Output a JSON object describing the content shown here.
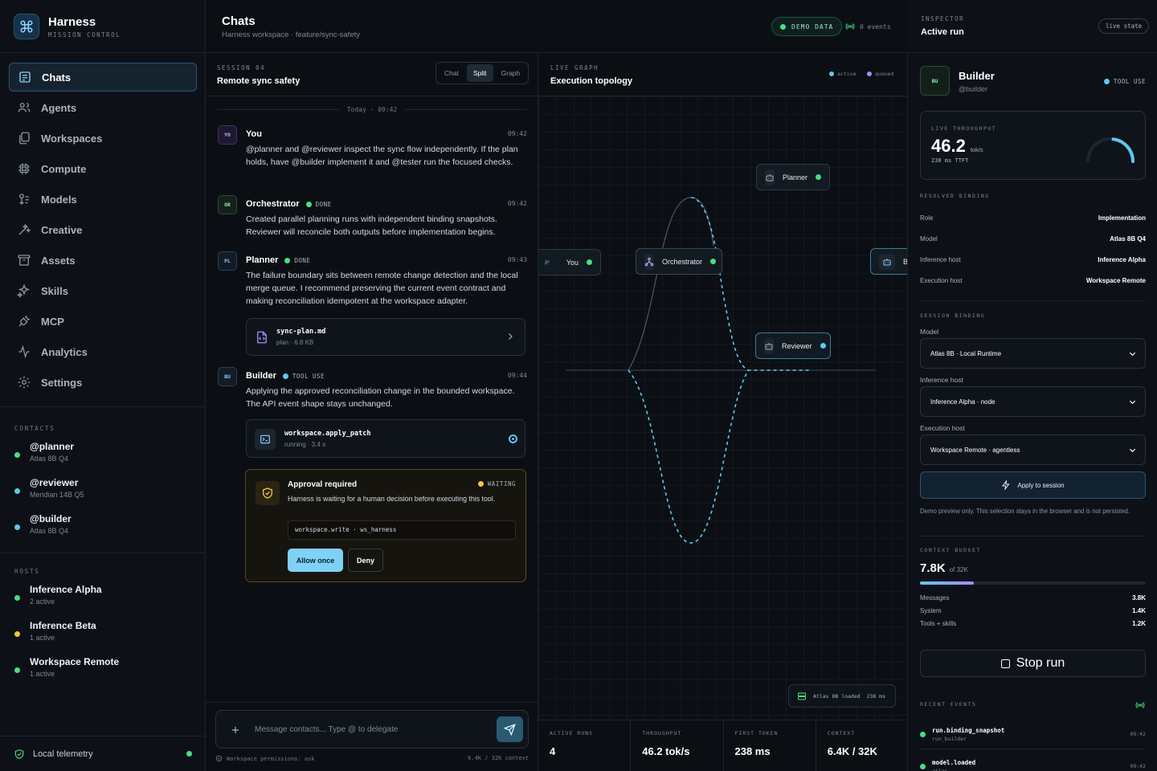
{
  "app": {
    "name": "Harness",
    "subtitle": "MISSION CONTROL"
  },
  "nav": [
    {
      "label": "Chats",
      "icon": "chat-icon",
      "active": true
    },
    {
      "label": "Agents",
      "icon": "users-icon"
    },
    {
      "label": "Workspaces",
      "icon": "workspaces-icon"
    },
    {
      "label": "Compute",
      "icon": "chip-icon"
    },
    {
      "label": "Models",
      "icon": "models-icon"
    },
    {
      "label": "Creative",
      "icon": "wand-icon"
    },
    {
      "label": "Assets",
      "icon": "archive-icon"
    },
    {
      "label": "Skills",
      "icon": "sparkles-icon"
    },
    {
      "label": "MCP",
      "icon": "plug-icon"
    },
    {
      "label": "Analytics",
      "icon": "activity-icon"
    },
    {
      "label": "Settings",
      "icon": "gear-icon"
    }
  ],
  "contacts": {
    "label": "CONTACTS",
    "items": [
      {
        "name": "@planner",
        "model": "Atlas 8B Q4",
        "color": "#4ade80"
      },
      {
        "name": "@reviewer",
        "model": "Meridian 14B Q5",
        "color": "#5ec8f0"
      },
      {
        "name": "@builder",
        "model": "Atlas 8B Q4",
        "color": "#5ec8f0"
      }
    ]
  },
  "hosts": {
    "label": "HOSTS",
    "items": [
      {
        "name": "Inference Alpha",
        "status": "2 active",
        "color": "#4ade80"
      },
      {
        "name": "Inference Beta",
        "status": "1 active",
        "color": "#f5c542"
      },
      {
        "name": "Workspace Remote",
        "status": "1 active",
        "color": "#4ade80"
      }
    ]
  },
  "telemetry": {
    "label": "Local telemetry"
  },
  "header": {
    "title": "Chats",
    "subtitle": "Harness workspace · feature/sync-safety",
    "badge": "DEMO DATA",
    "events": "0 events"
  },
  "chat": {
    "session_label": "SESSION 04",
    "session_title": "Remote sync safety",
    "views": [
      "Chat",
      "Split",
      "Graph"
    ],
    "active_view": "Split",
    "date_divider": "Today · 09:42",
    "messages": [
      {
        "avatar": "YO",
        "name": "You",
        "time": "09:42",
        "body": "@planner and @reviewer inspect the sync flow independently. If the plan holds, have @builder implement it and @tester run the focused checks."
      },
      {
        "avatar": "OR",
        "name": "Orchestrator",
        "status": "DONE",
        "time": "09:42",
        "body": "Created parallel planning runs with independent binding snapshots. Reviewer will reconcile both outputs before implementation begins."
      },
      {
        "avatar": "PL",
        "name": "Planner",
        "status": "DONE",
        "time": "09:43",
        "body": "The failure boundary sits between remote change detection and the local merge queue. I recommend preserving the current event contract and making reconciliation idempotent at the workspace adapter."
      },
      {
        "avatar": "BU",
        "name": "Builder",
        "status": "TOOL USE",
        "time": "09:44",
        "body": "Applying the approved reconciliation change in the bounded workspace. The API event shape stays unchanged."
      }
    ],
    "file_card": {
      "name": "sync-plan.md",
      "meta": "plan · 6.8 KB"
    },
    "tool_card": {
      "name": "workspace.apply_patch",
      "meta": "running · 3.4 s"
    },
    "approval": {
      "title": "Approval required",
      "status": "WAITING",
      "body": "Harness is waiting for a human decision before executing this tool.",
      "command": "workspace.write · ws_harness",
      "allow": "Allow once",
      "deny": "Deny"
    },
    "composer": {
      "placeholder": "Message contacts... Type @ to delegate",
      "permissions": "Workspace permissions: ask",
      "context": "6.4K / 32K context"
    }
  },
  "graph": {
    "label": "LIVE GRAPH",
    "title": "Execution topology",
    "legend_active": "active",
    "legend_queued": "queued",
    "nodes": {
      "you": "You",
      "orchestrator": "Orchestrator",
      "planner": "Planner",
      "reviewer": "Reviewer",
      "builder": "Bu"
    },
    "atlas_chip": "Atlas 8B loaded  238 ms",
    "stats": [
      {
        "label": "ACTIVE RUNS",
        "value": "4"
      },
      {
        "label": "THROUGHPUT",
        "value": "46.2 tok/s"
      },
      {
        "label": "FIRST TOKEN",
        "value": "238 ms"
      },
      {
        "label": "CONTEXT",
        "value": "6.4K / 32K"
      }
    ]
  },
  "inspector": {
    "label": "INSPECTOR",
    "title": "Active run",
    "live_pill": "live state",
    "agent": {
      "avatar": "BU",
      "name": "Builder",
      "handle": "@builder",
      "status": "TOOL USE"
    },
    "throughput": {
      "label": "LIVE THROUGHPUT",
      "value": "46.2",
      "unit": "tok/s",
      "ttft": "238 ms TTFT",
      "gauge_fraction": 0.46
    },
    "resolved": {
      "label": "RESOLVED BINDING",
      "rows": [
        {
          "k": "Role",
          "v": "Implementation"
        },
        {
          "k": "Model",
          "v": "Atlas 8B Q4"
        },
        {
          "k": "Inference host",
          "v": "Inference Alpha"
        },
        {
          "k": "Execution host",
          "v": "Workspace Remote"
        }
      ]
    },
    "session_binding": {
      "label": "SESSION BINDING",
      "model_label": "Model",
      "model_value": "Atlas 8B · Local Runtime",
      "inference_label": "Inference host",
      "inference_value": "Inference Alpha · node",
      "execution_label": "Execution host",
      "execution_value": "Workspace Remote · agentless",
      "apply": "Apply to session",
      "note": "Demo preview only. This selection stays in the browser and is not persisted."
    },
    "context": {
      "label": "CONTEXT BUDGET",
      "value": "7.8K",
      "of": "of 32K",
      "fraction": 0.24,
      "rows": [
        {
          "k": "Messages",
          "v": "3.8K"
        },
        {
          "k": "System",
          "v": "1.4K"
        },
        {
          "k": "Tools + skills",
          "v": "1.2K"
        }
      ]
    },
    "stop": "Stop run",
    "events": {
      "label": "RECENT EVENTS",
      "items": [
        {
          "name": "run.binding_snapshot",
          "sub": "run_builder",
          "time": "09:42"
        },
        {
          "name": "model.loaded",
          "sub": "atlas",
          "time": "09:42"
        }
      ]
    }
  },
  "colors": {
    "accent": "#5ec8f0",
    "green": "#4ade80",
    "amber": "#f5c542",
    "purple": "#a78bfa"
  }
}
